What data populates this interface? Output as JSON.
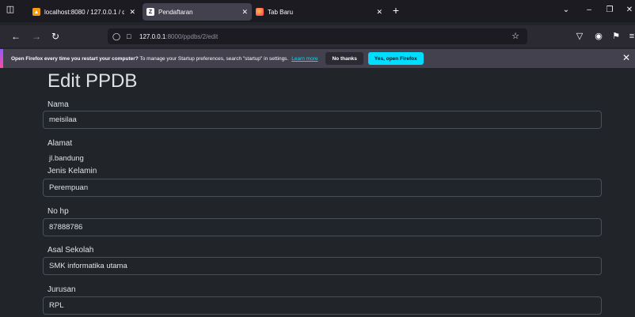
{
  "browser": {
    "tabs": [
      {
        "title": "localhost:8080 / 127.0.0.1 / db_",
        "favicon": "phpmyadmin-icon",
        "active": false
      },
      {
        "title": "Pendaftaran",
        "favicon": "laravel-icon",
        "active": true
      },
      {
        "title": "Tab Baru",
        "favicon": "firefox-icon",
        "active": false
      }
    ],
    "url_host": "127.0.0.1",
    "url_path": ":8000/ppdbs/2/edit"
  },
  "notification": {
    "bold_text": "Open Firefox every time you restart your computer?",
    "text": " To manage your Startup preferences, search \"startup\" in settings.",
    "link": "Learn more",
    "secondary_button": "No thanks",
    "primary_button": "Yes, open Firefox"
  },
  "form": {
    "title": "Edit PPDB",
    "fields": [
      {
        "label": "Nama",
        "value": "meisilaa"
      },
      {
        "label": "Alamat",
        "value": "jl.bandung"
      },
      {
        "label": "Jenis Kelamin",
        "value": "Perempuan"
      },
      {
        "label": "No hp",
        "value": "87888786"
      },
      {
        "label": "Asal Sekolah",
        "value": "SMK informatika utama"
      },
      {
        "label": "Jurusan",
        "value": "RPL"
      }
    ]
  },
  "colors": {
    "page_bg": "#212529",
    "input_border": "#495057",
    "accent": "#00ddff"
  }
}
